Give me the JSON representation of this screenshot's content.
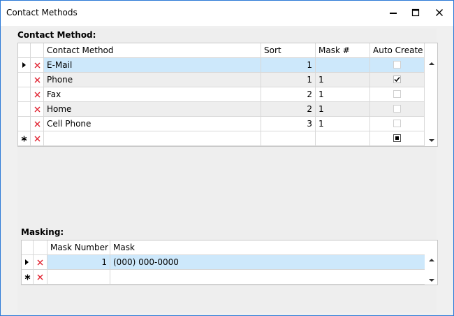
{
  "window": {
    "title": "Contact Methods"
  },
  "contact_method": {
    "label": "Contact Method:",
    "headers": {
      "name": "Contact Method",
      "sort": "Sort",
      "mask": "Mask #",
      "auto": "Auto Create"
    },
    "rows": [
      {
        "name": "E-Mail",
        "sort": "1",
        "mask": "",
        "auto": false,
        "selected": true
      },
      {
        "name": "Phone",
        "sort": "1",
        "mask": "1",
        "auto": true,
        "selected": false
      },
      {
        "name": "Fax",
        "sort": "2",
        "mask": "1",
        "auto": false,
        "selected": false
      },
      {
        "name": "Home",
        "sort": "2",
        "mask": "1",
        "auto": false,
        "selected": false
      },
      {
        "name": "Cell Phone",
        "sort": "3",
        "mask": "1",
        "auto": false,
        "selected": false
      }
    ]
  },
  "masking": {
    "label": "Masking:",
    "headers": {
      "number": "Mask Number",
      "mask": "Mask"
    },
    "rows": [
      {
        "number": "1",
        "mask": "(000) 000-0000",
        "selected": true
      }
    ]
  },
  "icons": {
    "minimize": "minimize-icon",
    "maximize": "maximize-icon",
    "close": "close-icon",
    "delete": "delete-x-icon",
    "current_row": "row-pointer-icon",
    "new_row": "new-row-asterisk-icon"
  },
  "colors": {
    "selected_row": "#cde8fb",
    "delete_x": "#e0202e",
    "window_border": "#2b79d6"
  }
}
